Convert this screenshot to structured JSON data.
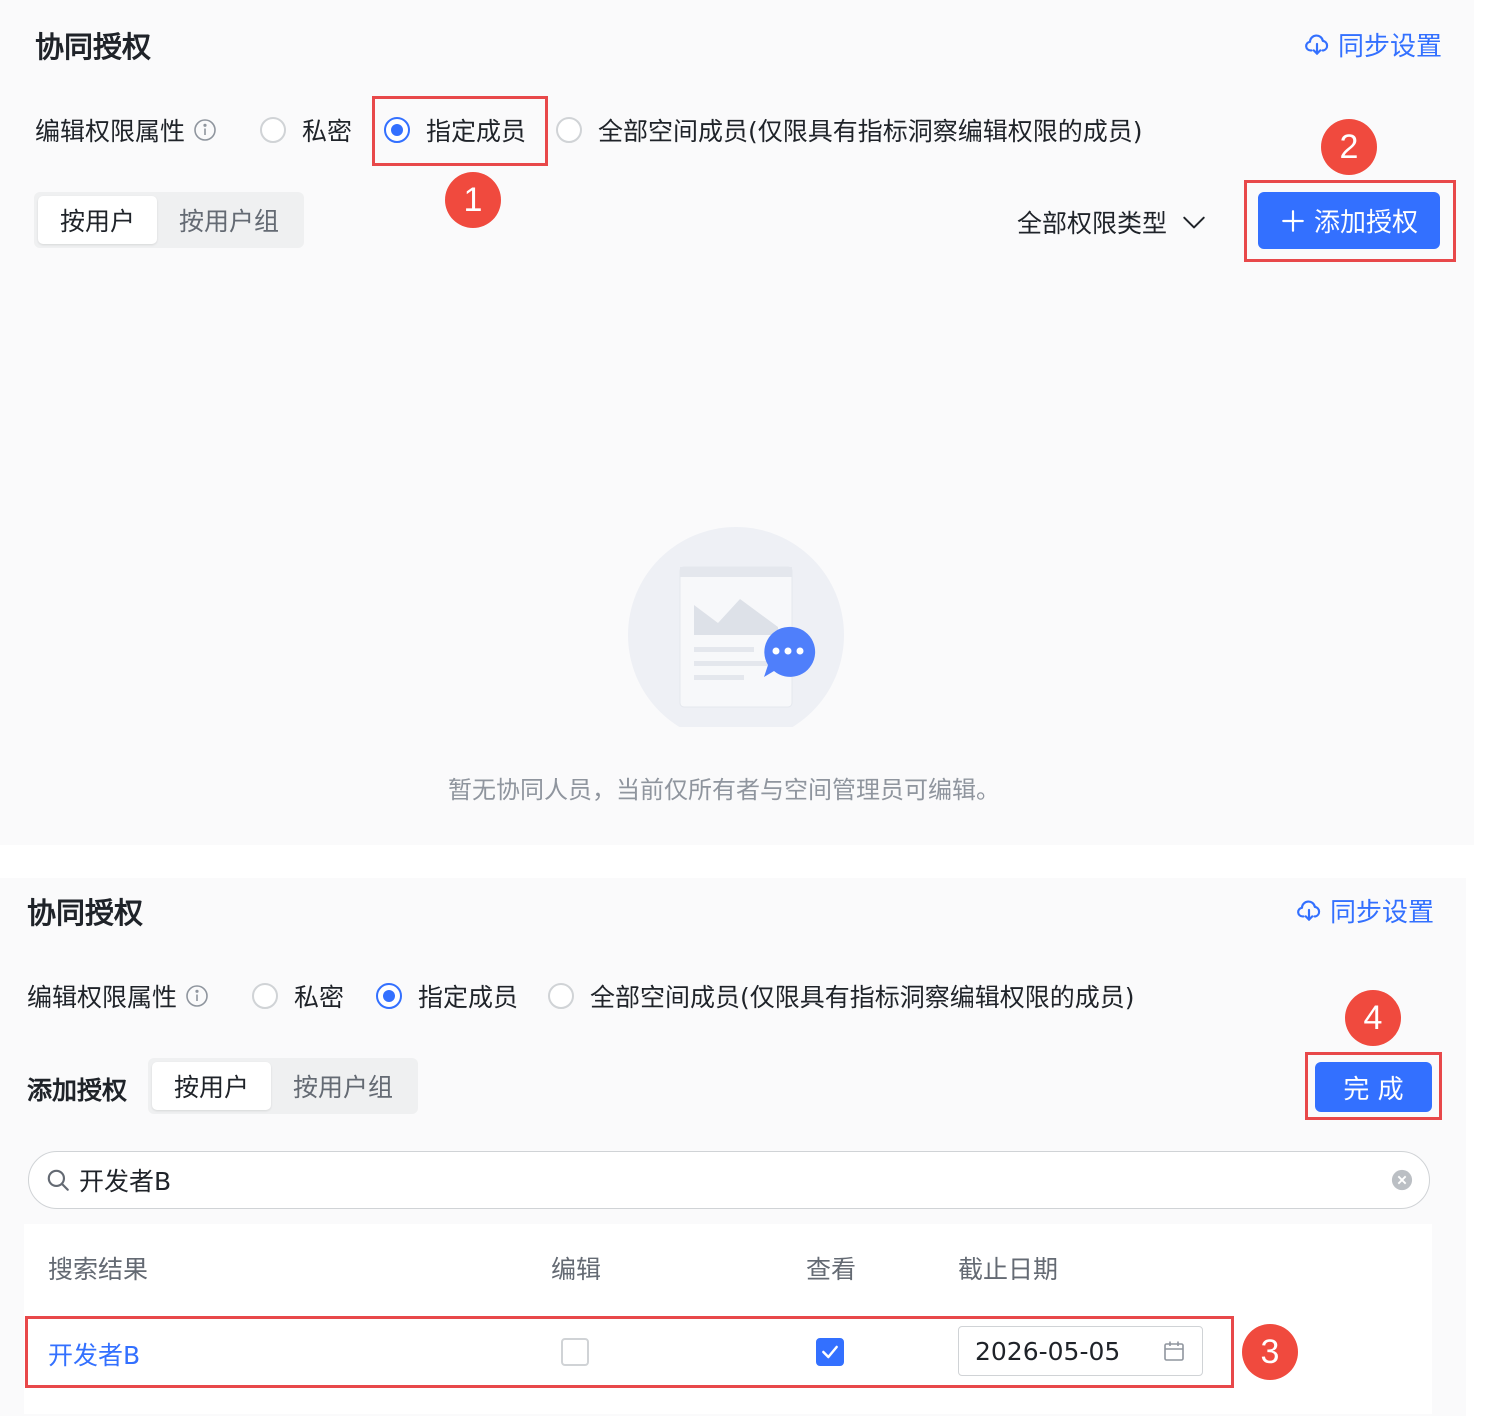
{
  "top": {
    "title": "协同授权",
    "sync_label": "同步设置",
    "permission_label": "编辑权限属性",
    "options": [
      "私密",
      "指定成员",
      "全部空间成员(仅限具有指标洞察编辑权限的成员)"
    ],
    "selected_option": "指定成员",
    "segment": [
      "按用户",
      "按用户组"
    ],
    "active_segment": "按用户",
    "filter_label": "全部权限类型",
    "add_button": "添加授权",
    "empty_text": "暂无协同人员，当前仅所有者与空间管理员可编辑。"
  },
  "bottom": {
    "title": "协同授权",
    "sync_label": "同步设置",
    "permission_label": "编辑权限属性",
    "options": [
      "私密",
      "指定成员",
      "全部空间成员(仅限具有指标洞察编辑权限的成员)"
    ],
    "selected_option": "指定成员",
    "add_label": "添加授权",
    "segment": [
      "按用户",
      "按用户组"
    ],
    "active_segment": "按用户",
    "done_button": "完 成",
    "search_value": "开发者B",
    "columns": [
      "搜索结果",
      "编辑",
      "查看",
      "截止日期"
    ],
    "row": {
      "name": "开发者B",
      "edit": false,
      "view": true,
      "deadline": "2026-05-05"
    }
  },
  "badges": [
    "1",
    "2",
    "3",
    "4"
  ],
  "colors": {
    "accent": "#3370ff",
    "highlight": "#e8484a",
    "badge": "#f04a3e"
  },
  "icons": [
    "cloud-download-icon",
    "info-icon",
    "chevron-down-icon",
    "plus-icon",
    "search-icon",
    "clear-icon",
    "calendar-icon",
    "check-icon",
    "empty-state-illustration"
  ]
}
